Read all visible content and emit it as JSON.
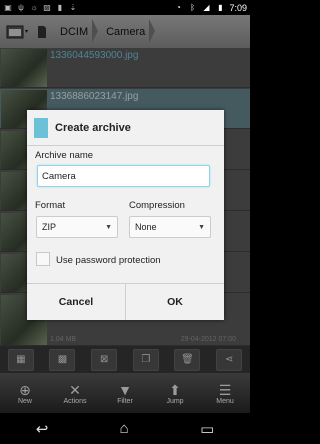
{
  "status": {
    "time": "7:09"
  },
  "path": {
    "crumbs": [
      "DCIM",
      "Camera"
    ]
  },
  "files": [
    {
      "name": "1336044593000.jpg",
      "size": "",
      "date": ""
    },
    {
      "name": "1336886023147.jpg",
      "size": "",
      "date": ""
    },
    {
      "name": "",
      "size": "1.04 MB",
      "date": "29-04-2012 07:00"
    }
  ],
  "scroll_indicator": "3",
  "toolbar": {
    "new": "New",
    "actions": "Actions",
    "filter": "Filter",
    "jump": "Jump",
    "menu": "Menu"
  },
  "dialog": {
    "title": "Create archive",
    "archive_name_label": "Archive name",
    "archive_name_value": "Camera",
    "format_label": "Format",
    "format_value": "ZIP",
    "compression_label": "Compression",
    "compression_value": "None",
    "password_label": "Use password protection",
    "cancel": "Cancel",
    "ok": "OK"
  },
  "colors": {
    "accent": "#6cc1d7",
    "file_name": "#7cc9e2"
  }
}
